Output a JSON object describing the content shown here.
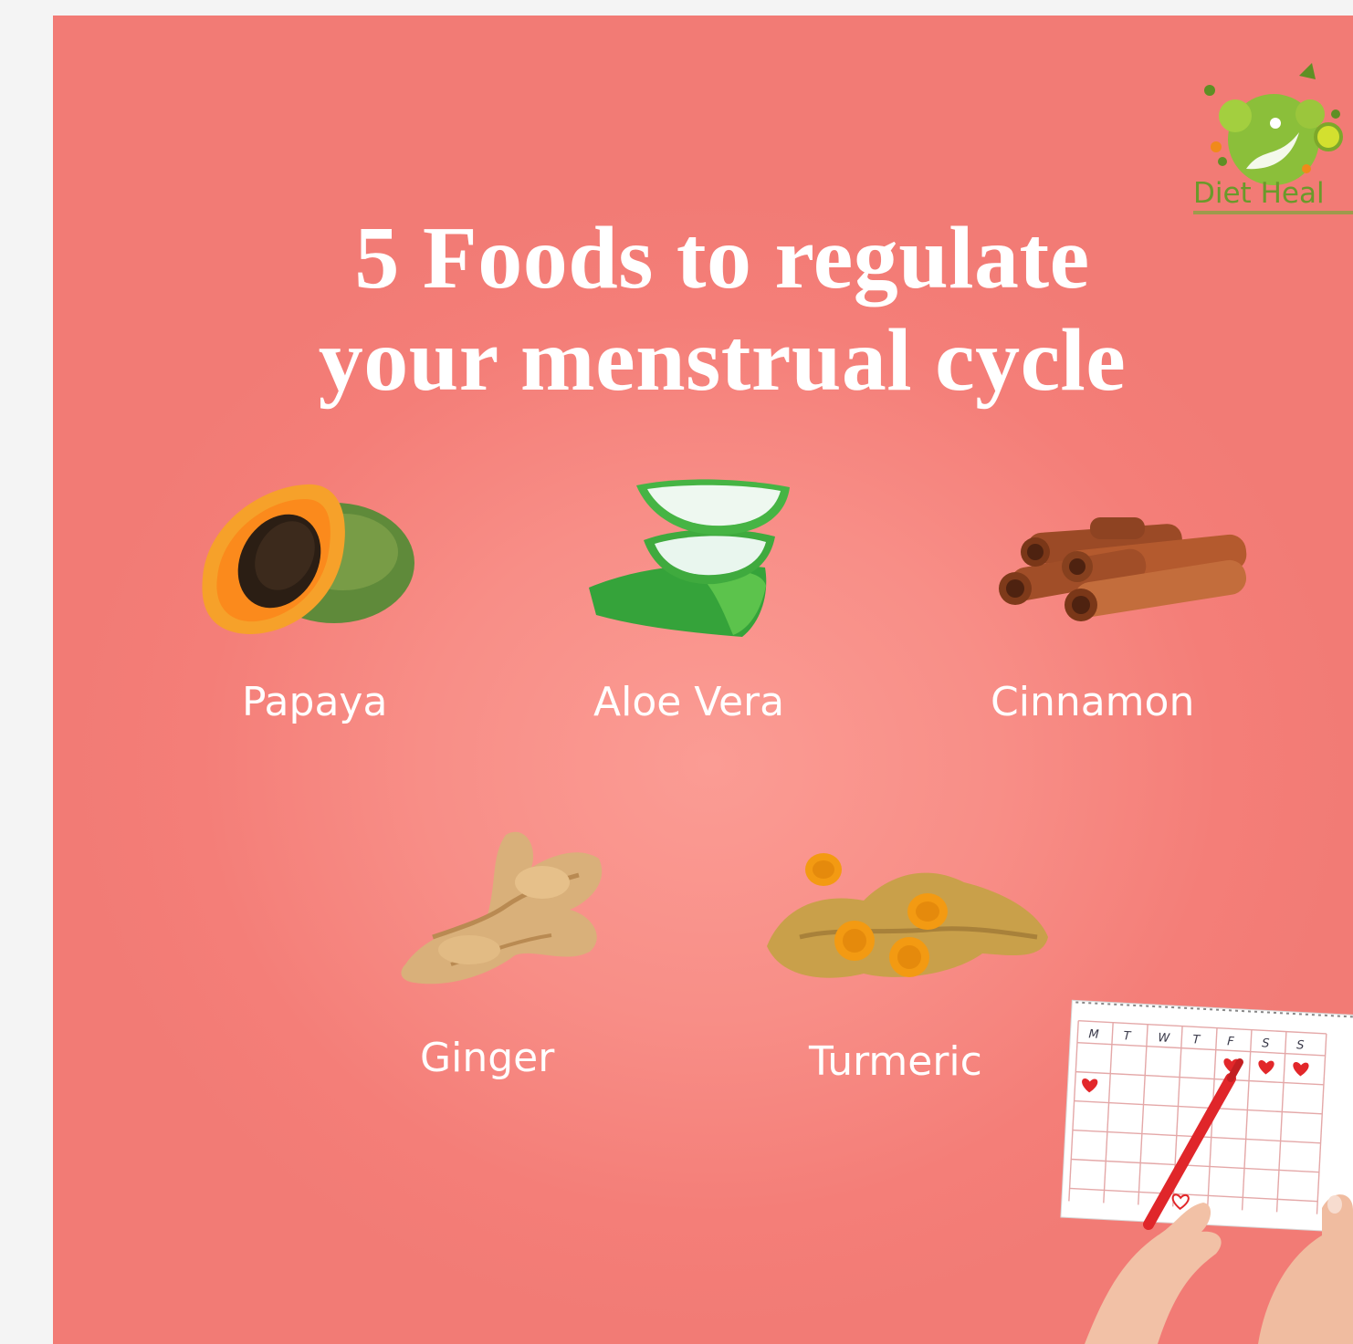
{
  "brand": {
    "name": "Diet Heal",
    "logo_icon": "leaf-fruit-logo",
    "colors": {
      "green": "#8bbf3a",
      "dark_green": "#5f8f24",
      "lime": "#d3e02f",
      "orange": "#f08a1a"
    }
  },
  "title": {
    "line1": "5 Foods to regulate",
    "line2": "your menstrual cycle"
  },
  "colors": {
    "background": "#f88e87",
    "text": "#ffffff"
  },
  "foods": [
    {
      "label": "Papaya",
      "icon": "papaya-icon"
    },
    {
      "label": "Aloe Vera",
      "icon": "aloe-vera-icon"
    },
    {
      "label": "Cinnamon",
      "icon": "cinnamon-icon"
    },
    {
      "label": "Ginger",
      "icon": "ginger-icon"
    },
    {
      "label": "Turmeric",
      "icon": "turmeric-icon"
    }
  ],
  "calendar": {
    "icon": "calendar-with-hearts-icon",
    "weekdays": [
      "M",
      "T",
      "W",
      "T",
      "F",
      "S",
      "S"
    ]
  }
}
